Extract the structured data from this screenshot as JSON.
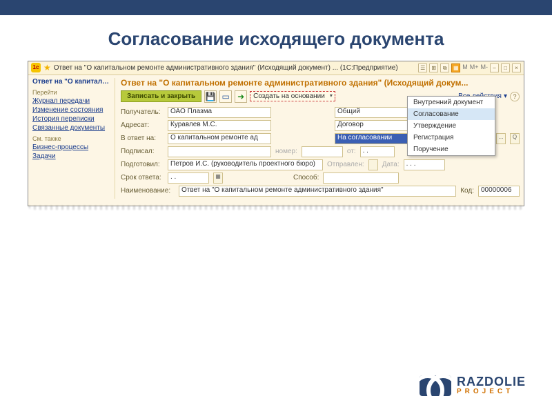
{
  "slide": {
    "title": "Согласование исходящего документа"
  },
  "window": {
    "title": "Ответ на \"О капитальном ремонте административного здания\" (Исходящий документ) ... (1С:Предприятие)",
    "toolbar_right": {
      "m": "M",
      "mplus": "M+",
      "mminus": "M-"
    }
  },
  "sidebar": {
    "active": "Ответ на \"О капиталь…",
    "group1_head": "Перейти",
    "group1": [
      "Журнал передачи",
      "Изменение состояния",
      "История переписки",
      "Связанные документы"
    ],
    "group2_head": "См. также",
    "group2": [
      "Бизнес-процессы",
      "Задачи"
    ]
  },
  "doc": {
    "title": "Ответ на \"О капитальном ремонте административного здания\" (Исходящий докум...",
    "save_close": "Записать и закрыть",
    "create_based": "Создать на основании",
    "all_actions": "Все действия",
    "fields": {
      "recipient_label": "Получатель:",
      "recipient_value": "ОАО Плазма",
      "addressee_label": "Адресат:",
      "addressee_value": "Куравлев М.С.",
      "inreply_label": "В ответ на:",
      "inreply_value": "О капитальном ремонте ад",
      "signed_label": "Подписал:",
      "signed_value": "",
      "prepared_label": "Подготовил:",
      "prepared_value": "Петров И.С. (руководитель проектного бюро)",
      "deadline_label": "Срок ответа:",
      "deadline_value": ". .",
      "name_label": "Наименование:",
      "name_value": "Ответ на \"О капитальном ремонте административного здания\"",
      "type_value": "Общий",
      "kind_value": "Договор",
      "state_value": "На согласовании",
      "num_label": "номер:",
      "num_value": "",
      "from_label": "от:",
      "from_value": ". .",
      "sent_label": "Отправлен:",
      "sent_value": "",
      "date_label": "Дата:",
      "date_value": ". . .",
      "method_label": "Способ:",
      "method_value": "",
      "code_label": "Код:",
      "code_value": "00000006"
    }
  },
  "popup": {
    "items": [
      "Внутренний документ",
      "Согласование",
      "Утверждение",
      "Регистрация",
      "Поручение"
    ],
    "selected_index": 1
  },
  "logo": {
    "name": "RAZDOLIE",
    "sub": "PROJECT"
  }
}
